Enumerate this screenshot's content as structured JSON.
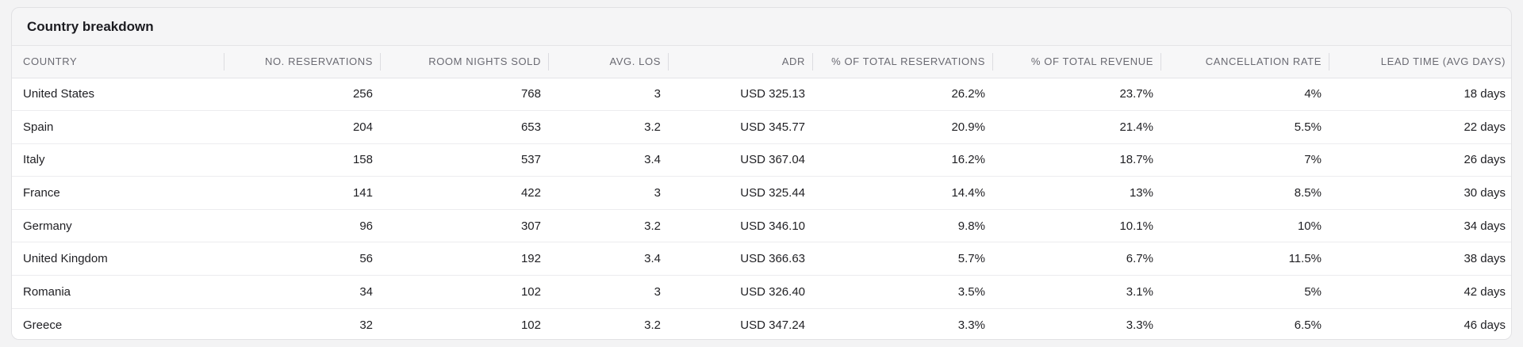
{
  "card": {
    "title": "Country breakdown"
  },
  "table": {
    "columns": [
      "COUNTRY",
      "NO. RESERVATIONS",
      "ROOM NIGHTS SOLD",
      "AVG. LOS",
      "ADR",
      "% OF TOTAL RESERVATIONS",
      "% OF TOTAL REVENUE",
      "CANCELLATION RATE",
      "LEAD TIME (AVG DAYS)"
    ],
    "rows": [
      [
        "United States",
        "256",
        "768",
        "3",
        "USD 325.13",
        "26.2%",
        "23.7%",
        "4%",
        "18 days"
      ],
      [
        "Spain",
        "204",
        "653",
        "3.2",
        "USD 345.77",
        "20.9%",
        "21.4%",
        "5.5%",
        "22 days"
      ],
      [
        "Italy",
        "158",
        "537",
        "3.4",
        "USD 367.04",
        "16.2%",
        "18.7%",
        "7%",
        "26 days"
      ],
      [
        "France",
        "141",
        "422",
        "3",
        "USD 325.44",
        "14.4%",
        "13%",
        "8.5%",
        "30 days"
      ],
      [
        "Germany",
        "96",
        "307",
        "3.2",
        "USD 346.10",
        "9.8%",
        "10.1%",
        "10%",
        "34 days"
      ],
      [
        "United Kingdom",
        "56",
        "192",
        "3.4",
        "USD 366.63",
        "5.7%",
        "6.7%",
        "11.5%",
        "38 days"
      ],
      [
        "Romania",
        "34",
        "102",
        "3",
        "USD 326.40",
        "3.5%",
        "3.1%",
        "5%",
        "42 days"
      ],
      [
        "Greece",
        "32",
        "102",
        "3.2",
        "USD 347.24",
        "3.3%",
        "3.3%",
        "6.5%",
        "46 days"
      ]
    ]
  }
}
